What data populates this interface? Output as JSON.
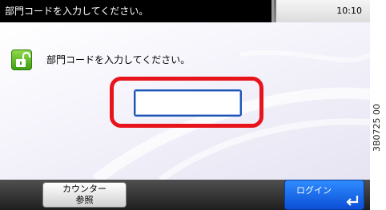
{
  "status": {
    "message": "部門コードを入力してください。",
    "time": "10:10"
  },
  "main": {
    "prompt": "部門コードを入力してください。",
    "code_input": {
      "value": "",
      "placeholder": ""
    },
    "icon": "unlock-icon"
  },
  "buttons": {
    "counter_line1": "カウンター",
    "counter_line2": "参照",
    "login": "ログイン"
  },
  "side_code": "3B0725 00",
  "colors": {
    "highlight": "#e8141c",
    "login_button": "#1a6ef0",
    "lock_icon": "#5cbf24"
  }
}
